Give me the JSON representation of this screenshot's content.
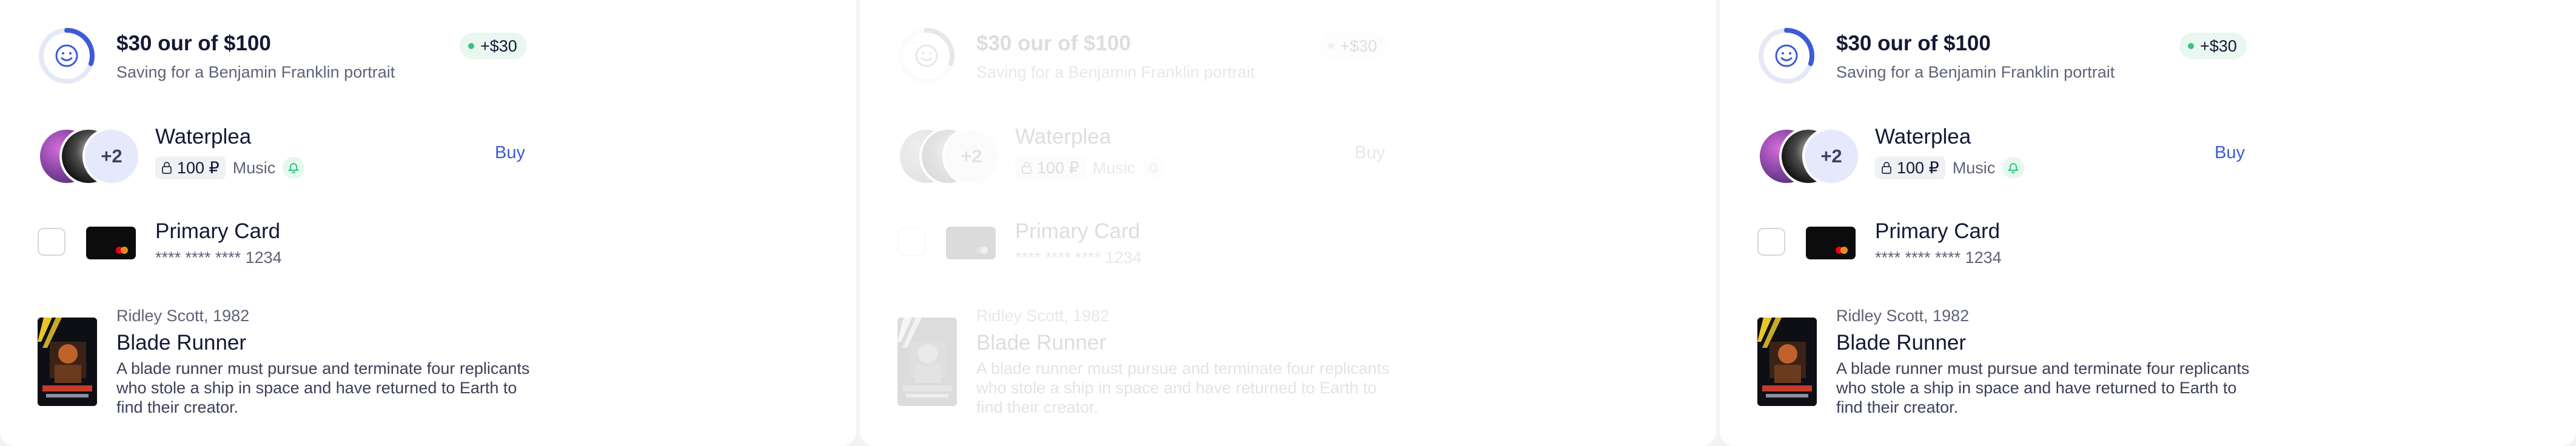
{
  "panels": [
    {
      "progress": {
        "title": "$30 our of $100",
        "subtitle": "Saving for a Benjamin Franklin portrait",
        "badge": "+$30",
        "percent": 30
      },
      "artist": {
        "name": "Waterplea",
        "price": "100 ₽",
        "genre": "Music",
        "extra_count": "+2",
        "action": "Buy"
      },
      "card": {
        "name": "Primary Card",
        "number": "**** **** **** 1234"
      },
      "movie": {
        "meta": "Ridley Scott, 1982",
        "title": "Blade Runner",
        "description": "A blade runner must pursue and terminate four replicants who stole a ship in space and have returned to Earth to find their creator."
      }
    },
    {
      "progress": {
        "title": "$30 our of $100",
        "subtitle": "Saving for a Benjamin Franklin portrait",
        "badge": "+$30",
        "percent": 30
      },
      "artist": {
        "name": "Waterplea",
        "price": "100 ₽",
        "genre": "Music",
        "extra_count": "+2",
        "action": "Buy"
      },
      "card": {
        "name": "Primary Card",
        "number": "**** **** **** 1234"
      },
      "movie": {
        "meta": "Ridley Scott, 1982",
        "title": "Blade Runner",
        "description": "A blade runner must pursue and terminate four replicants who stole a ship in space and have returned to Earth to find their creator."
      }
    },
    {
      "progress": {
        "title": "$30 our of $100",
        "subtitle": "Saving for a Benjamin Franklin portrait",
        "badge": "+$30",
        "percent": 30
      },
      "artist": {
        "name": "Waterplea",
        "price": "100 ₽",
        "genre": "Music",
        "extra_count": "+2",
        "action": "Buy"
      },
      "card": {
        "name": "Primary Card",
        "number": "**** **** **** 1234"
      },
      "movie": {
        "meta": "Ridley Scott, 1982",
        "title": "Blade Runner",
        "description": "A blade runner must pursue and terminate four replicants who stole a ship in space and have returned to Earth to find their creator."
      }
    }
  ],
  "icons": {
    "progress": "smile-icon",
    "price": "lock-icon",
    "notify": "bell-icon",
    "card_brand": "mastercard-icon"
  },
  "colors": {
    "accent": "#3d5bd6",
    "success": "#33c47f",
    "ring_track": "#e6e9f5",
    "text": "#141833",
    "muted": "#5f6378"
  }
}
